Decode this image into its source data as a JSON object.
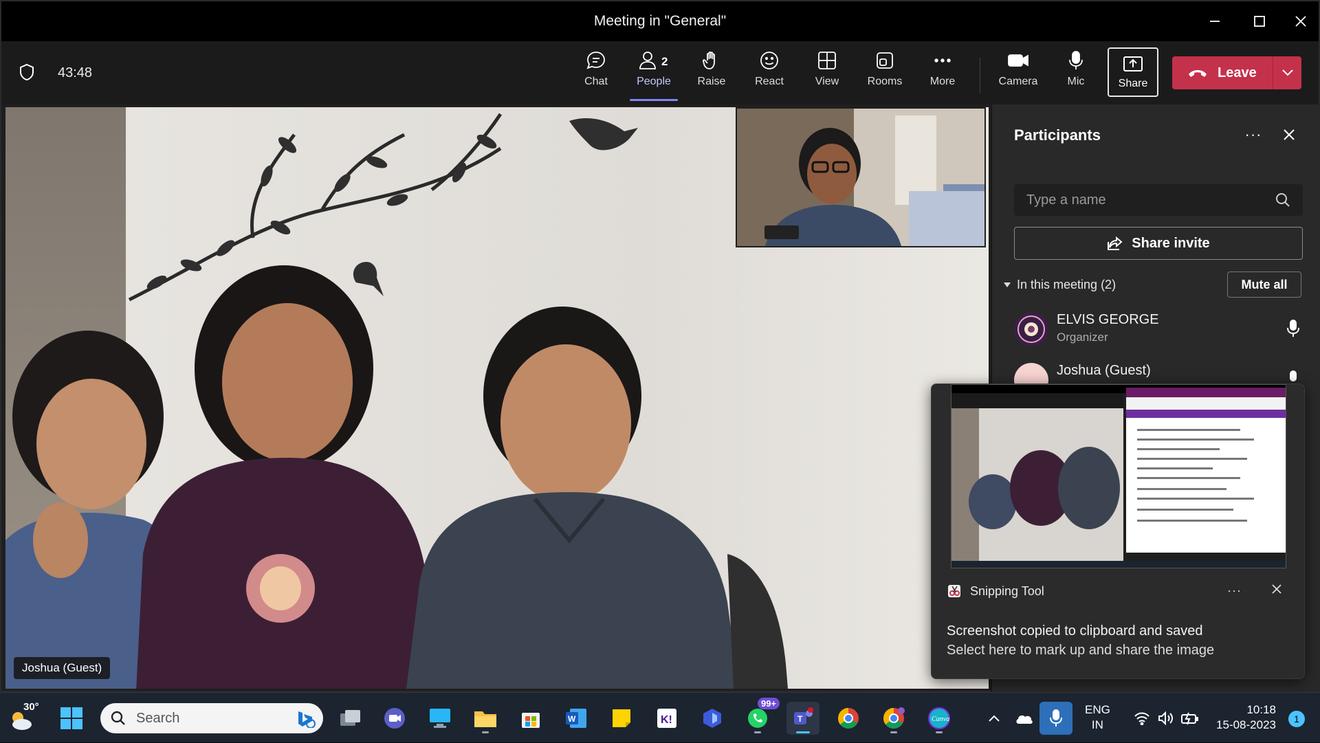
{
  "window": {
    "title": "Meeting in \"General\""
  },
  "toolbar": {
    "timer": "43:48",
    "chat_label": "Chat",
    "people_label": "People",
    "people_count": "2",
    "raise_label": "Raise",
    "react_label": "React",
    "view_label": "View",
    "rooms_label": "Rooms",
    "more_label": "More",
    "camera_label": "Camera",
    "mic_label": "Mic",
    "share_label": "Share",
    "leave_label": "Leave",
    "leave_color": "#c4314b",
    "active_color": "#7f85f5"
  },
  "stage": {
    "speaker_name": "Joshua (Guest)"
  },
  "panel": {
    "title": "Participants",
    "more": "···",
    "search_placeholder": "Type a name",
    "share_invite_label": "Share invite",
    "section_label": "In this meeting (2)",
    "mute_all_label": "Mute all",
    "participants": [
      {
        "name": "ELVIS GEORGE",
        "role": "Organizer"
      },
      {
        "name": "Joshua (Guest)",
        "role": ""
      }
    ]
  },
  "toast": {
    "app_name": "Snipping Tool",
    "more": "···",
    "line1": "Screenshot copied to clipboard and saved",
    "line2": "Select here to mark up and share the image"
  },
  "taskbar": {
    "temperature": "30°",
    "search_label": "Search",
    "whatsapp_badge": "99+",
    "lang_line1": "ENG",
    "lang_line2": "IN",
    "time": "10:18",
    "date": "15-08-2023",
    "notifications": "1"
  }
}
